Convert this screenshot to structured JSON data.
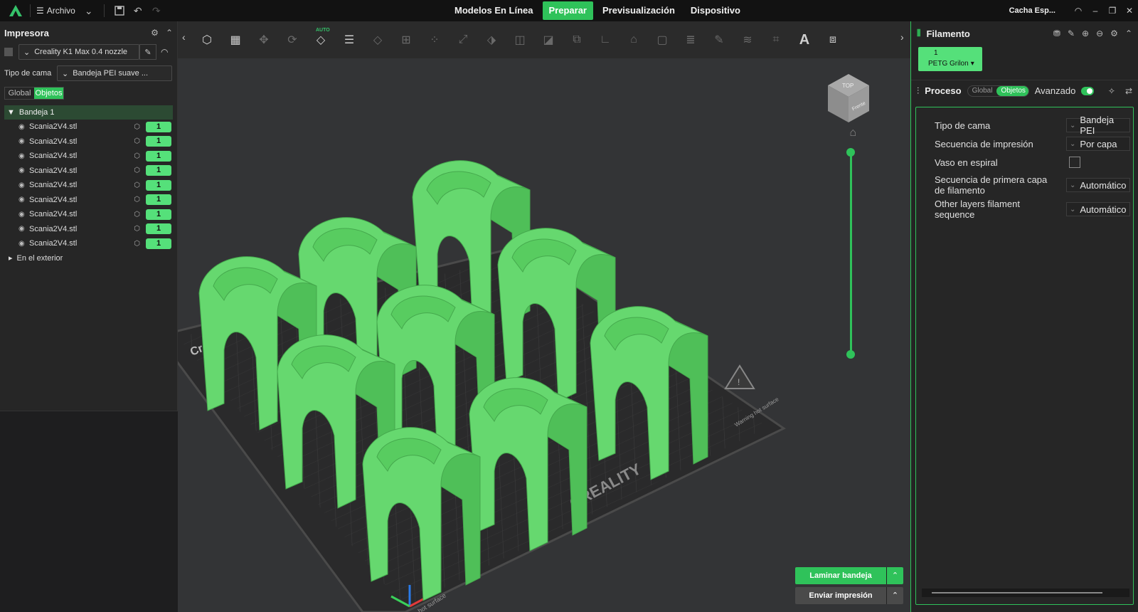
{
  "topbar": {
    "menu_label": "Archivo",
    "tabs": [
      "Modelos En Línea",
      "Preparar",
      "Previsualización",
      "Dispositivo"
    ],
    "user": "Cacha Esp..."
  },
  "left": {
    "title": "Impresora",
    "printer": "Creality K1 Max 0.4 nozzle",
    "bed_label": "Tipo de cama",
    "bed_value": "Bandeja PEI suave ...",
    "seg": [
      "Global",
      "Objetos"
    ],
    "plate": "Bandeja 1",
    "objects": [
      {
        "name": "Scania2V4.stl",
        "count": "1"
      },
      {
        "name": "Scania2V4.stl",
        "count": "1"
      },
      {
        "name": "Scania2V4.stl",
        "count": "1"
      },
      {
        "name": "Scania2V4.stl",
        "count": "1"
      },
      {
        "name": "Scania2V4.stl",
        "count": "1"
      },
      {
        "name": "Scania2V4.stl",
        "count": "1"
      },
      {
        "name": "Scania2V4.stl",
        "count": "1"
      },
      {
        "name": "Scania2V4.stl",
        "count": "1"
      },
      {
        "name": "Scania2V4.stl",
        "count": "1"
      }
    ],
    "outside": "En el exterior"
  },
  "viewport": {
    "bed_brand": "CREALITY",
    "bed_brand_left": "Cre",
    "warning_text": "Warning hot surface",
    "hot_surface": "hot surface",
    "navcube_top": "TOP",
    "navcube_front": "Frente",
    "slice_button": "Laminar bandeja",
    "send_button": "Enviar impresión",
    "auto_label": "AUTO"
  },
  "right": {
    "filament_title": "Filamento",
    "filament_num": "1",
    "filament_name": "PETG Grilon",
    "process_title": "Proceso",
    "process_seg": [
      "Global",
      "Objetos"
    ],
    "advanced": "Avanzado",
    "rows": [
      {
        "label": "Tipo de cama",
        "value": "Bandeja PEI"
      },
      {
        "label": "Secuencia de impresión",
        "value": "Por capa"
      },
      {
        "label": "Vaso en espiral",
        "value": ""
      },
      {
        "label": "Secuencia de primera capa de filamento",
        "value": "Automático"
      },
      {
        "label": "Other layers filament sequence",
        "value": "Automático"
      }
    ]
  },
  "colors": {
    "accent": "#2fc25a",
    "model": "#66d86f",
    "bed": "#2b2b2c"
  }
}
